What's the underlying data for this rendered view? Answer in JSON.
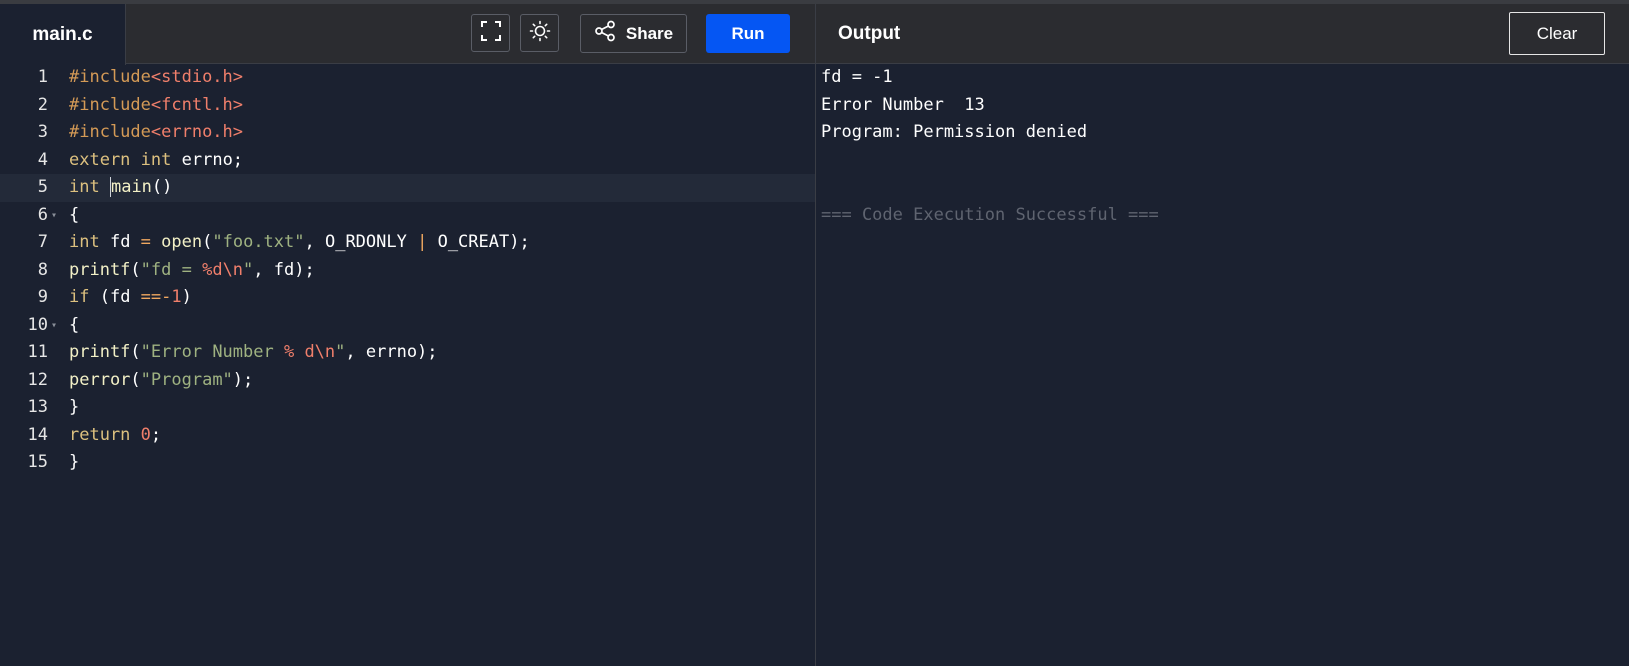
{
  "editor": {
    "filename": "main.c",
    "lines": [
      {
        "num": "1",
        "tokens": [
          {
            "t": "#include",
            "c": "directive"
          },
          {
            "t": "<stdio.h>",
            "c": "header"
          }
        ]
      },
      {
        "num": "2",
        "tokens": [
          {
            "t": "#include",
            "c": "directive"
          },
          {
            "t": "<fcntl.h>",
            "c": "header"
          }
        ]
      },
      {
        "num": "3",
        "tokens": [
          {
            "t": "#include",
            "c": "directive"
          },
          {
            "t": "<errno.h>",
            "c": "header"
          }
        ]
      },
      {
        "num": "4",
        "tokens": [
          {
            "t": "extern",
            "c": "keyword"
          },
          {
            "t": " ",
            "c": "punct"
          },
          {
            "t": "int",
            "c": "keyword"
          },
          {
            "t": " errno;",
            "c": "ident"
          }
        ]
      },
      {
        "num": "5",
        "active": true,
        "tokens": [
          {
            "t": "int",
            "c": "keyword"
          },
          {
            "t": " ",
            "c": "punct"
          },
          {
            "t": "cursor",
            "c": "cursor"
          },
          {
            "t": "main",
            "c": "func"
          },
          {
            "t": "()",
            "c": "punct"
          }
        ]
      },
      {
        "num": "6",
        "fold": true,
        "tokens": [
          {
            "t": "{",
            "c": "punct"
          }
        ]
      },
      {
        "num": "7",
        "tokens": [
          {
            "t": "int",
            "c": "keyword"
          },
          {
            "t": " fd ",
            "c": "ident"
          },
          {
            "t": "=",
            "c": "op"
          },
          {
            "t": " ",
            "c": "punct"
          },
          {
            "t": "open",
            "c": "func"
          },
          {
            "t": "(",
            "c": "punct"
          },
          {
            "t": "\"foo.txt\"",
            "c": "string"
          },
          {
            "t": ", O_RDONLY ",
            "c": "ident"
          },
          {
            "t": "|",
            "c": "op"
          },
          {
            "t": " O_CREAT);",
            "c": "ident"
          }
        ]
      },
      {
        "num": "8",
        "tokens": [
          {
            "t": "printf",
            "c": "func"
          },
          {
            "t": "(",
            "c": "punct"
          },
          {
            "t": "\"fd = ",
            "c": "string"
          },
          {
            "t": "%d\\n",
            "c": "format"
          },
          {
            "t": "\"",
            "c": "string"
          },
          {
            "t": ", fd);",
            "c": "ident"
          }
        ]
      },
      {
        "num": "9",
        "tokens": [
          {
            "t": "if",
            "c": "keyword"
          },
          {
            "t": " (fd ",
            "c": "ident"
          },
          {
            "t": "==-",
            "c": "op"
          },
          {
            "t": "1",
            "c": "number"
          },
          {
            "t": ")",
            "c": "punct"
          }
        ]
      },
      {
        "num": "10",
        "fold": true,
        "tokens": [
          {
            "t": "{",
            "c": "punct"
          }
        ]
      },
      {
        "num": "11",
        "tokens": [
          {
            "t": "printf",
            "c": "func"
          },
          {
            "t": "(",
            "c": "punct"
          },
          {
            "t": "\"Error Number ",
            "c": "string"
          },
          {
            "t": "% d\\n",
            "c": "format"
          },
          {
            "t": "\"",
            "c": "string"
          },
          {
            "t": ", errno);",
            "c": "ident"
          }
        ]
      },
      {
        "num": "12",
        "tokens": [
          {
            "t": "perror",
            "c": "func"
          },
          {
            "t": "(",
            "c": "punct"
          },
          {
            "t": "\"Program\"",
            "c": "string"
          },
          {
            "t": ");",
            "c": "punct"
          }
        ]
      },
      {
        "num": "13",
        "tokens": [
          {
            "t": "}",
            "c": "punct"
          }
        ]
      },
      {
        "num": "14",
        "tokens": [
          {
            "t": "return",
            "c": "keyword"
          },
          {
            "t": " ",
            "c": "punct"
          },
          {
            "t": "0",
            "c": "number"
          },
          {
            "t": ";",
            "c": "punct"
          }
        ]
      },
      {
        "num": "15",
        "tokens": [
          {
            "t": "}",
            "c": "punct"
          }
        ]
      }
    ]
  },
  "toolbar": {
    "fullscreen_icon": "fullscreen-icon",
    "theme_icon": "sun-icon",
    "share_icon": "share-icon",
    "share_label": "Share",
    "run_label": "Run"
  },
  "output": {
    "title": "Output",
    "clear_label": "Clear",
    "lines": [
      {
        "text": "fd = -1",
        "kind": "stdout"
      },
      {
        "text": "Error Number  13",
        "kind": "stdout"
      },
      {
        "text": "Program: Permission denied",
        "kind": "stdout"
      },
      {
        "text": "",
        "kind": "blank"
      },
      {
        "text": "",
        "kind": "blank"
      },
      {
        "text": "=== Code Execution Successful ===",
        "kind": "success"
      }
    ]
  },
  "colors": {
    "background": "#1b2130",
    "topbar": "#2b2c30",
    "run_button": "#0556f3",
    "keyword": "#dcc07f",
    "string": "#9fb281",
    "header": "#f07f6b",
    "success_text": "#5f6470"
  }
}
